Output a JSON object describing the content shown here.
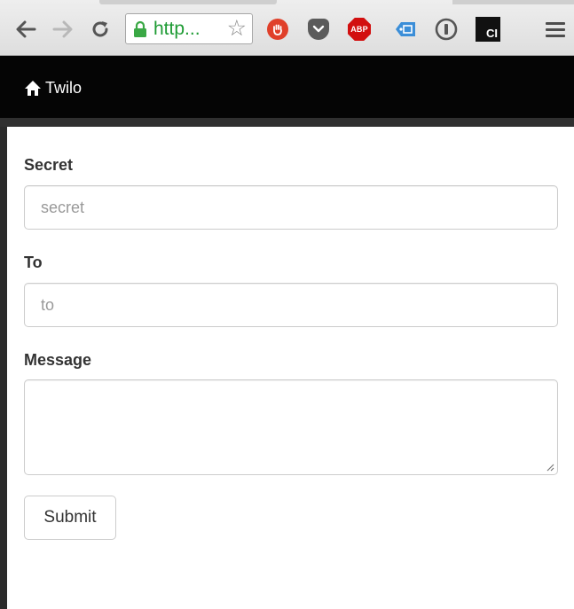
{
  "browser": {
    "url_display": "http...",
    "extensions": {
      "abp_label": "ABP",
      "ci_label": "CI"
    }
  },
  "navbar": {
    "brand_label": "Twilo"
  },
  "form": {
    "secret_label": "Secret",
    "secret_placeholder": "secret",
    "to_label": "To",
    "to_placeholder": "to",
    "message_label": "Message",
    "submit_label": "Submit"
  }
}
